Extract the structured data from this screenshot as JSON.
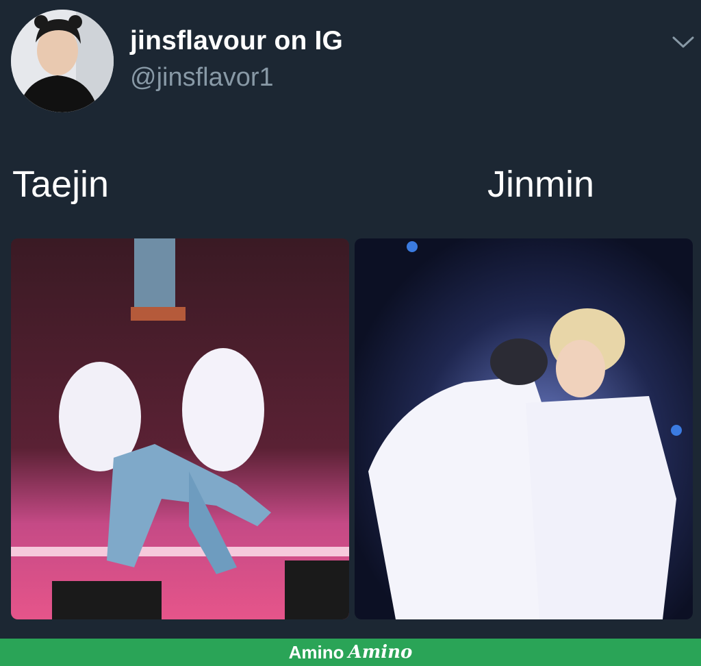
{
  "tweet": {
    "display_name": "jinsflavour on IG",
    "handle": "@jinsflavor1",
    "menu_icon": "chevron-down-icon"
  },
  "meme": {
    "left_caption": "Taejin",
    "right_caption": "Jinmin"
  },
  "footer": {
    "brand_text": "Amino",
    "brand_logo_text": "Amino"
  },
  "colors": {
    "background": "#1c2733",
    "secondary_text": "#8899a6",
    "footer_bar": "#2aa457"
  }
}
